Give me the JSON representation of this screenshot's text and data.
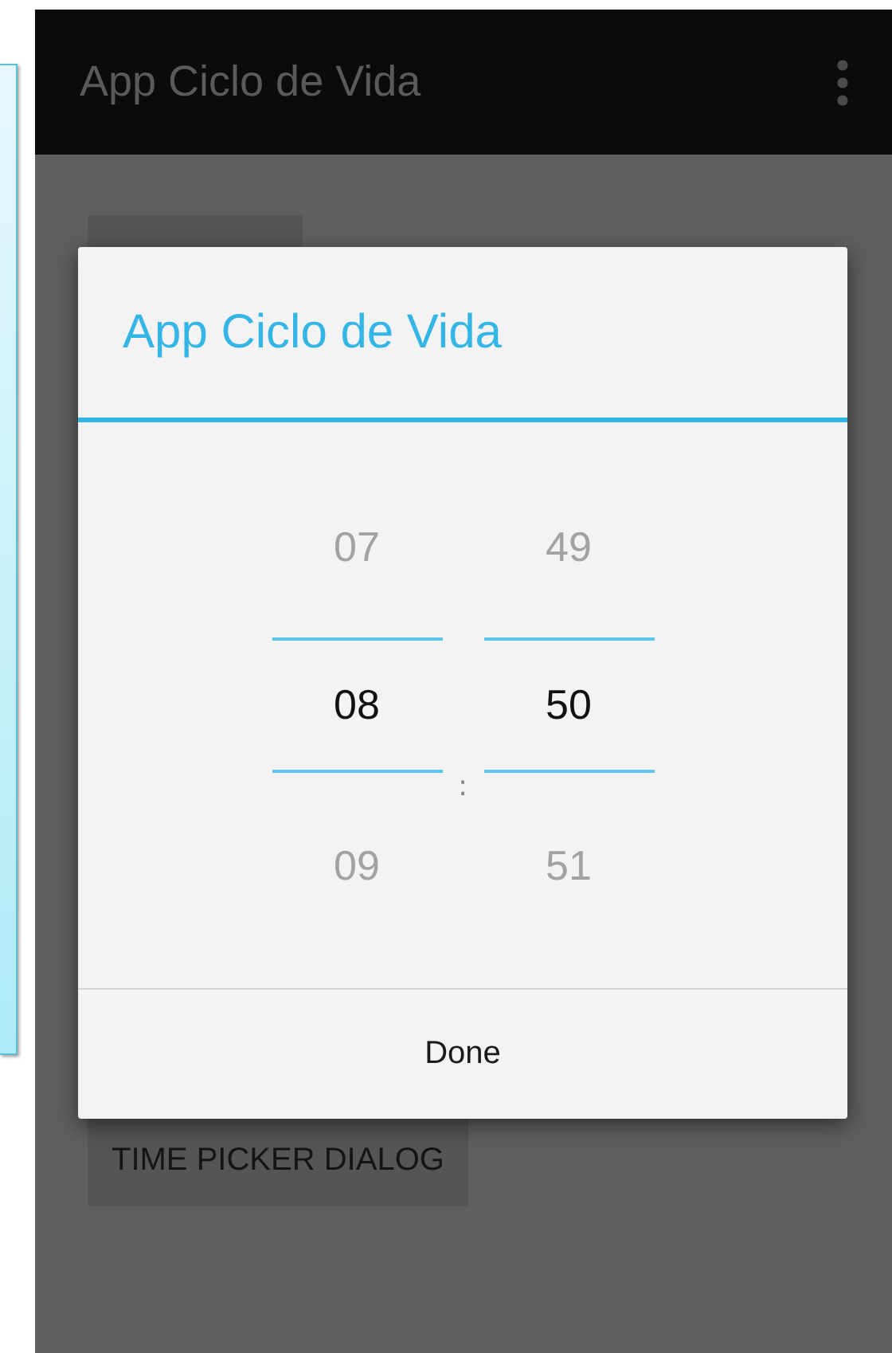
{
  "action_bar": {
    "title": "App Ciclo de Vida"
  },
  "buttons": [
    {
      "label": "TIME PICKER DIALOG"
    }
  ],
  "dialog": {
    "title": "App Ciclo de Vida",
    "picker": {
      "separator": ":",
      "columns": [
        {
          "values": [
            {
              "text": "07",
              "selected": false
            },
            {
              "text": "08",
              "selected": true
            },
            {
              "text": "09",
              "selected": false
            }
          ]
        },
        {
          "values": [
            {
              "text": "49",
              "selected": false
            },
            {
              "text": "50",
              "selected": true
            },
            {
              "text": "51",
              "selected": false
            }
          ]
        }
      ]
    },
    "button": "Done"
  }
}
